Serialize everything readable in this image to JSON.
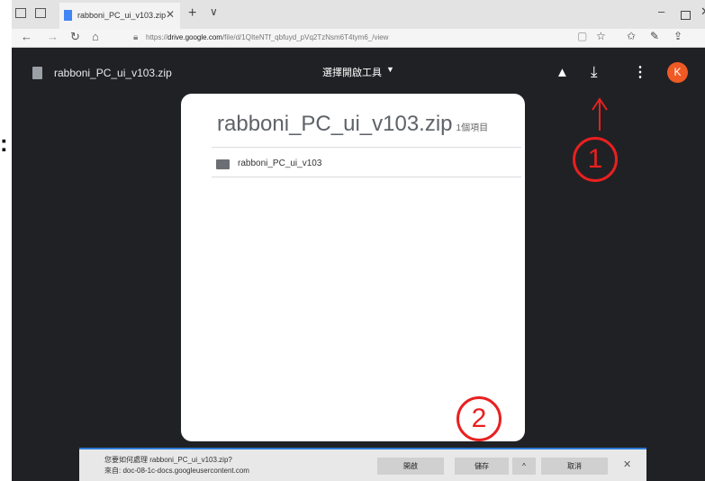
{
  "side_mark": ":",
  "browser": {
    "tab_title": "rabboni_PC_ui_v103.zip",
    "url_prefix": "https://",
    "url_domain": "drive.google.com",
    "url_path": "/file/d/1QIteNTf_qbfuyd_pVq2TzNsm6T4tym6_/view",
    "icons": [
      "tab-preview-icon",
      "tabs-aside-icon",
      "close-icon",
      "plus-icon",
      "chevron-down-icon",
      "back-icon",
      "forward-icon",
      "refresh-icon",
      "home-icon",
      "reading-view-icon",
      "star-icon",
      "favorites-icon",
      "pen-icon",
      "share-icon"
    ]
  },
  "drive": {
    "file_name": "rabboni_PC_ui_v103.zip",
    "open_with": "選擇開啟工具",
    "avatar_letter": "K",
    "avatar_color": "#ef5a24"
  },
  "card": {
    "title": "rabboni_PC_ui_v103.zip",
    "count": "1個項目",
    "items": [
      {
        "name": "rabboni_PC_ui_v103"
      }
    ]
  },
  "download_bar": {
    "question": "您要如何處理 rabboni_PC_ui_v103.zip?",
    "source": "來自: doc-08-1c-docs.googleusercontent.com",
    "open_label": "開啟",
    "save_label": "儲存",
    "expand_label": "^",
    "cancel_label": "取消",
    "accent": "#2b7bd6"
  },
  "annotations": {
    "step1": "1",
    "step2": "2",
    "color": "#e82020"
  }
}
